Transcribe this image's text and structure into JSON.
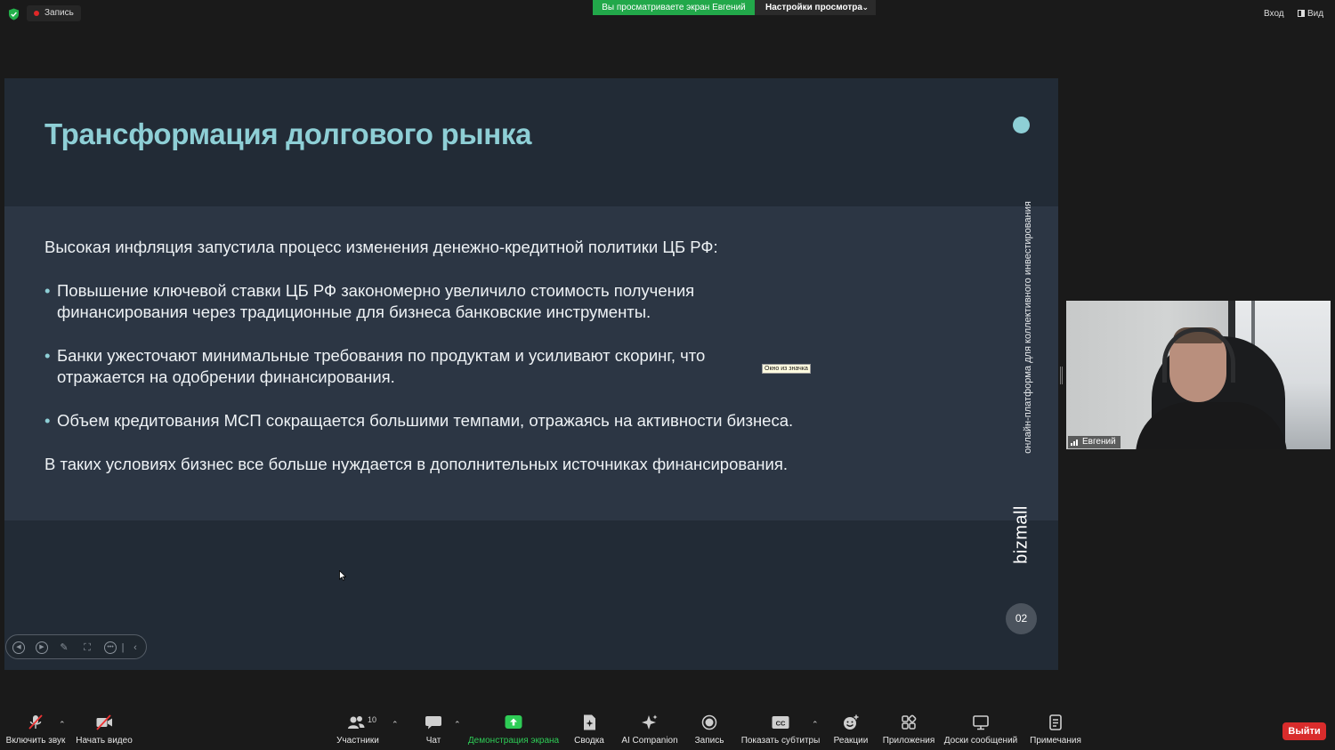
{
  "top_bar": {
    "recording_label": "Запись",
    "viewing_banner": "Вы просматриваете экран Евгений",
    "view_settings_label": "Настройки просмотра",
    "enter_label": "Вход",
    "view_label": "Вид"
  },
  "slide": {
    "title": "Трансформация долгового рынка",
    "intro": "Высокая инфляция запустила процесс изменения денежно-кредитной политики ЦБ РФ:",
    "bullets": [
      {
        "line1": "Повышение ключевой ставки ЦБ РФ закономерно увеличило стоимость получения",
        "line2": "финансирования через традиционные для бизнеса банковские инструменты."
      },
      {
        "line1": "Банки ужесточают минимальные требования по продуктам и усиливают скоринг, что",
        "line2": "отражается на одобрении финансирования."
      },
      {
        "line1": "Объем кредитования МСП сокращается большими темпами, отражаясь на активности бизнеса."
      }
    ],
    "conclusion": "В таких условиях бизнес все больше нуждается в дополнительных источниках финансирования.",
    "vertical_caption": "онлайн-платформа для коллективного инвестирования",
    "brand": "bizmall",
    "page_number": "02",
    "accent_color": "#8ecfd6",
    "tooltip": "Окно из значка"
  },
  "video_tile": {
    "participant_name": "Евгений"
  },
  "toolbar": {
    "mic_label": "Включить звук",
    "video_label": "Начать видео",
    "participants_label": "Участники",
    "participants_count": "10",
    "chat_label": "Чат",
    "share_label": "Демонстрация экрана",
    "summary_label": "Сводка",
    "ai_label": "AI Companion",
    "record_label": "Запись",
    "captions_label": "Показать субтитры",
    "reactions_label": "Реакции",
    "apps_label": "Приложения",
    "whiteboards_label": "Доски сообщений",
    "notes_label": "Примечания",
    "leave_label": "Выйти"
  }
}
